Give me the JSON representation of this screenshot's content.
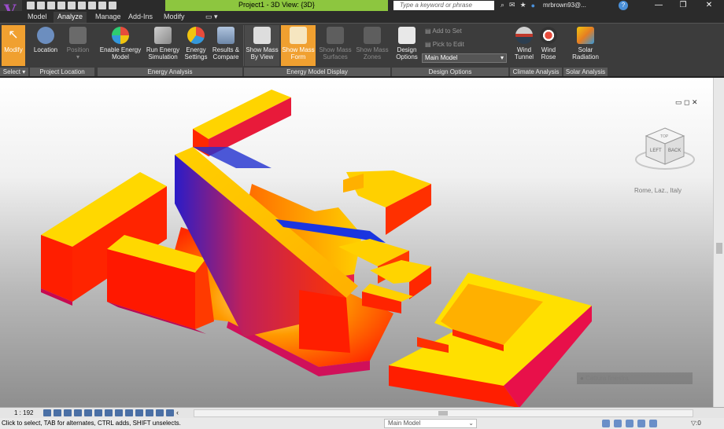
{
  "window": {
    "title": "Project1 - 3D View: {3D}",
    "search_placeholder": "Type a keyword or phrase",
    "user": "mrbrown93@...",
    "minimize": "—",
    "restore": "❐",
    "close": "✕"
  },
  "tabs": [
    "Model",
    "Analyze",
    "Manage",
    "Add-Ins",
    "Modify",
    "▭ ▾"
  ],
  "active_tab": "Analyze",
  "ribbon": {
    "modify": "Modify",
    "select": "Select ▾",
    "location": "Location",
    "position": "Position",
    "project_location": "Project Location",
    "enable_energy_1": "Enable Energy",
    "enable_energy_2": "Model",
    "run_energy_1": "Run Energy",
    "run_energy_2": "Simulation",
    "energy_settings_1": "Energy",
    "energy_settings_2": "Settings",
    "results_1": "Results &",
    "results_2": "Compare",
    "energy_analysis": "Energy Analysis",
    "show_mass_view_1": "Show Mass",
    "show_mass_view_2": "By View",
    "show_mass_form_1": "Show Mass",
    "show_mass_form_2": "Form",
    "show_mass_surfaces_1": "Show Mass",
    "show_mass_surfaces_2": "Surfaces",
    "show_mass_zones_1": "Show Mass",
    "show_mass_zones_2": "Zones",
    "energy_model_display": "Energy Model Display",
    "design_1": "Design",
    "design_2": "Options",
    "add_to_set": "Add to Set",
    "pick_to_edit": "Pick to Edit",
    "main_model": "Main Model",
    "design_options": "Design Options",
    "wind_tunnel_1": "Wind",
    "wind_tunnel_2": "Tunnel",
    "wind_rose_1": "Wind",
    "wind_rose_2": "Rose",
    "climate_analysis": "Climate Analysis",
    "solar_1": "Solar",
    "solar_2": "Radiation",
    "solar_analysis": "Solar Analysis"
  },
  "viewport": {
    "location": "Rome, Laz., Italy",
    "capture": "Cattura finestra",
    "controls": "▭ ◻ ✕"
  },
  "viewcube": {
    "left": "LEFT",
    "back": "BACK",
    "top": "TOP"
  },
  "view_control": {
    "scale": "1 : 192"
  },
  "status": {
    "text": "Click to select, TAB for alternates, CTRL adds, SHIFT unselects.",
    "model": "Main Model",
    "filter": "▽:0"
  }
}
